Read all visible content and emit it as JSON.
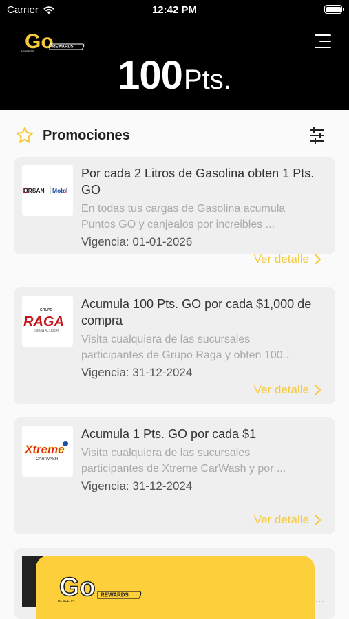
{
  "status_bar": {
    "carrier": "Carrier",
    "time": "12:42 PM"
  },
  "header": {
    "points_value": "100",
    "points_unit": "Pts.",
    "logo_text": "Go",
    "logo_sub": "REWARDS",
    "logo_small": "BENEFITS"
  },
  "section": {
    "title": "Promociones"
  },
  "promotions": [
    {
      "brand": "ORSAN Mobil",
      "title": "Por cada 2 Litros de Gasolina obten 1 Pts. GO",
      "desc_line1": "En todas tus cargas de Gasolina acumula",
      "desc_line2": "Puntos GO y canjealos por increibles ...",
      "validity": "Vigencia: 01-01-2026",
      "detail_label": "Ver detalle"
    },
    {
      "brand": "RAGA",
      "brand_top": "GRUPO",
      "brand_sub": "¡SIGAN AL LIDER!",
      "title": "Acumula 100 Pts. GO por cada $1,000 de compra",
      "desc_line1": "Visita cualquiera de las sucursales",
      "desc_line2": "participantes de Grupo Raga y obten 100...",
      "validity": "Vigencia: 31-12-2024",
      "detail_label": "Ver detalle"
    },
    {
      "brand": "Xtreme",
      "brand_sub": "CAR WASH",
      "title": "Acumula 1 Pts. GO por cada $1",
      "desc_line1": "Visita cualquiera de las sucursales",
      "desc_line2": "participantes de Xtreme CarWash y por ...",
      "validity": "Vigencia: 31-12-2024",
      "detail_label": "Ver detalle"
    }
  ],
  "partial_card": {
    "dots": "..."
  },
  "colors": {
    "accent": "#f6c93d",
    "header_bg": "#000000",
    "overlay_bg": "#fdcf3a"
  }
}
